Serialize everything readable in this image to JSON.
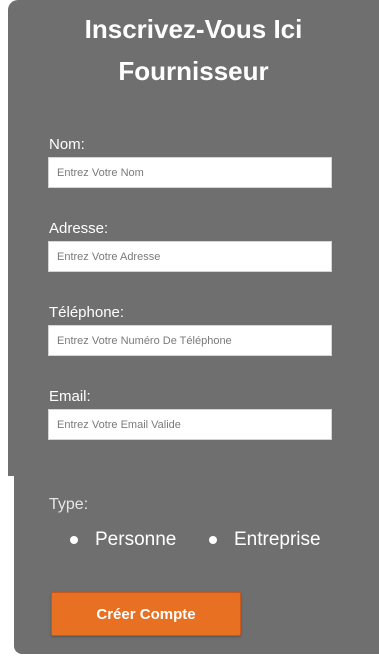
{
  "header": {
    "title_line1": "Inscrivez-Vous Ici",
    "title_line2": "Fournisseur"
  },
  "form": {
    "fields": [
      {
        "label": "Nom:",
        "placeholder": "Entrez Votre Nom",
        "value": ""
      },
      {
        "label": "Adresse:",
        "placeholder": "Entrez Votre Adresse",
        "value": ""
      },
      {
        "label": "Téléphone:",
        "placeholder": "Entrez Votre Numéro De Téléphone",
        "value": ""
      },
      {
        "label": "Email:",
        "placeholder": "Entrez Votre Email Valide",
        "value": ""
      }
    ],
    "type": {
      "label": "Type:",
      "options": [
        "Personne",
        "Entreprise"
      ]
    },
    "submit_label": "Créer Compte"
  },
  "colors": {
    "panel_bg": "#6f6f6f",
    "button_bg": "#e87023",
    "text": "#ffffff"
  }
}
